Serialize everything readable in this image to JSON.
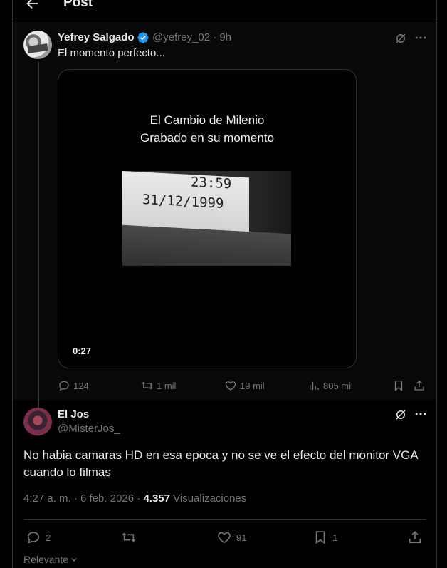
{
  "header": {
    "title": "Post"
  },
  "parent_tweet": {
    "author_name": "Yefrey Salgado",
    "handle_time": "@yefrey_02 · 9h",
    "text": "El momento perfecto...",
    "video": {
      "title_line1": "El Cambio de Milenio",
      "title_line2": "Grabado en su momento",
      "clock_time": "23:59",
      "clock_date": "31/12/1999",
      "duration": "0:27"
    },
    "actions": {
      "replies": "124",
      "reposts": "1 mil",
      "likes": "19 mil",
      "views": "805 mil"
    }
  },
  "reply": {
    "author_name": "El Jos",
    "handle": "@MisterJos_",
    "text": "No habia camaras HD en esa epoca y no se ve el efecto del monitor VGA cuando lo filmas",
    "timestamp": "4:27 a. m. · 6 feb. 2026 · ",
    "views_count": "4.357",
    "views_label": " Visualizaciones",
    "actions": {
      "replies": "2",
      "reposts": "",
      "likes": "91",
      "bookmarks": "1"
    }
  },
  "sort": {
    "label": "Relevante"
  },
  "colors": {
    "background": "#000000",
    "text": "#e7e9ea",
    "muted": "#71767b",
    "verified": "#1d9bf0",
    "border": "#2f3336"
  }
}
